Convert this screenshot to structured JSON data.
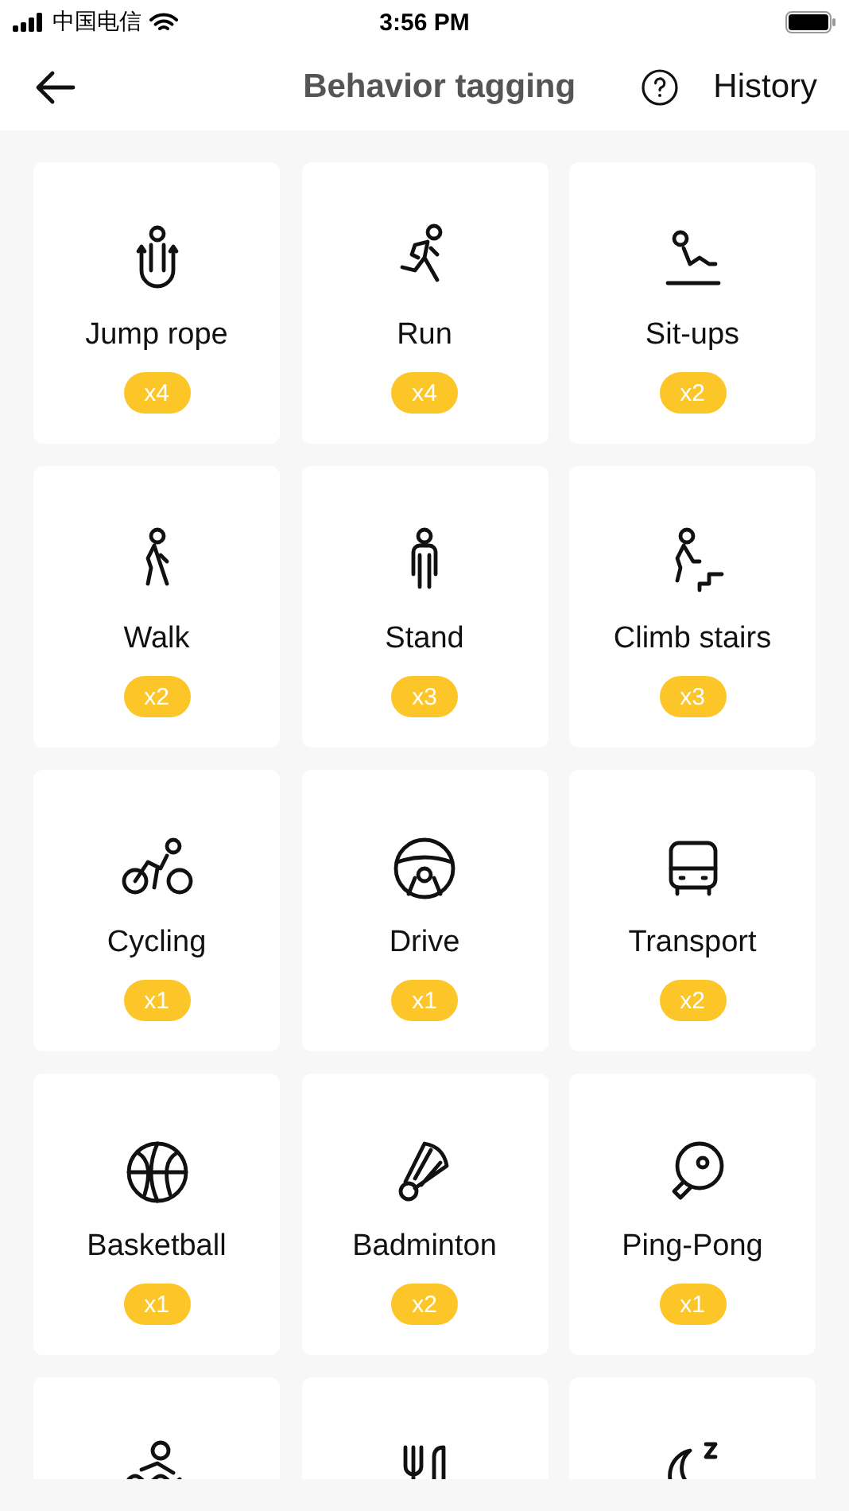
{
  "status_bar": {
    "carrier": "中国电信",
    "time": "3:56 PM"
  },
  "header": {
    "title": "Behavior tagging",
    "history": "History"
  },
  "tiles": [
    {
      "kind": "jump",
      "label": "Jump rope",
      "count": "x4"
    },
    {
      "kind": "run",
      "label": "Run",
      "count": "x4"
    },
    {
      "kind": "situp",
      "label": "Sit-ups",
      "count": "x2"
    },
    {
      "kind": "walk",
      "label": "Walk",
      "count": "x2"
    },
    {
      "kind": "stand",
      "label": "Stand",
      "count": "x3"
    },
    {
      "kind": "stairs",
      "label": "Climb stairs",
      "count": "x3"
    },
    {
      "kind": "cycle",
      "label": "Cycling",
      "count": "x1"
    },
    {
      "kind": "drive",
      "label": "Drive",
      "count": "x1"
    },
    {
      "kind": "bus",
      "label": "Transport",
      "count": "x2"
    },
    {
      "kind": "basketball",
      "label": "Basketball",
      "count": "x1"
    },
    {
      "kind": "badminton",
      "label": "Badminton",
      "count": "x2"
    },
    {
      "kind": "pingpong",
      "label": "Ping-Pong",
      "count": "x1"
    },
    {
      "kind": "swim"
    },
    {
      "kind": "dining"
    },
    {
      "kind": "sleep"
    }
  ]
}
